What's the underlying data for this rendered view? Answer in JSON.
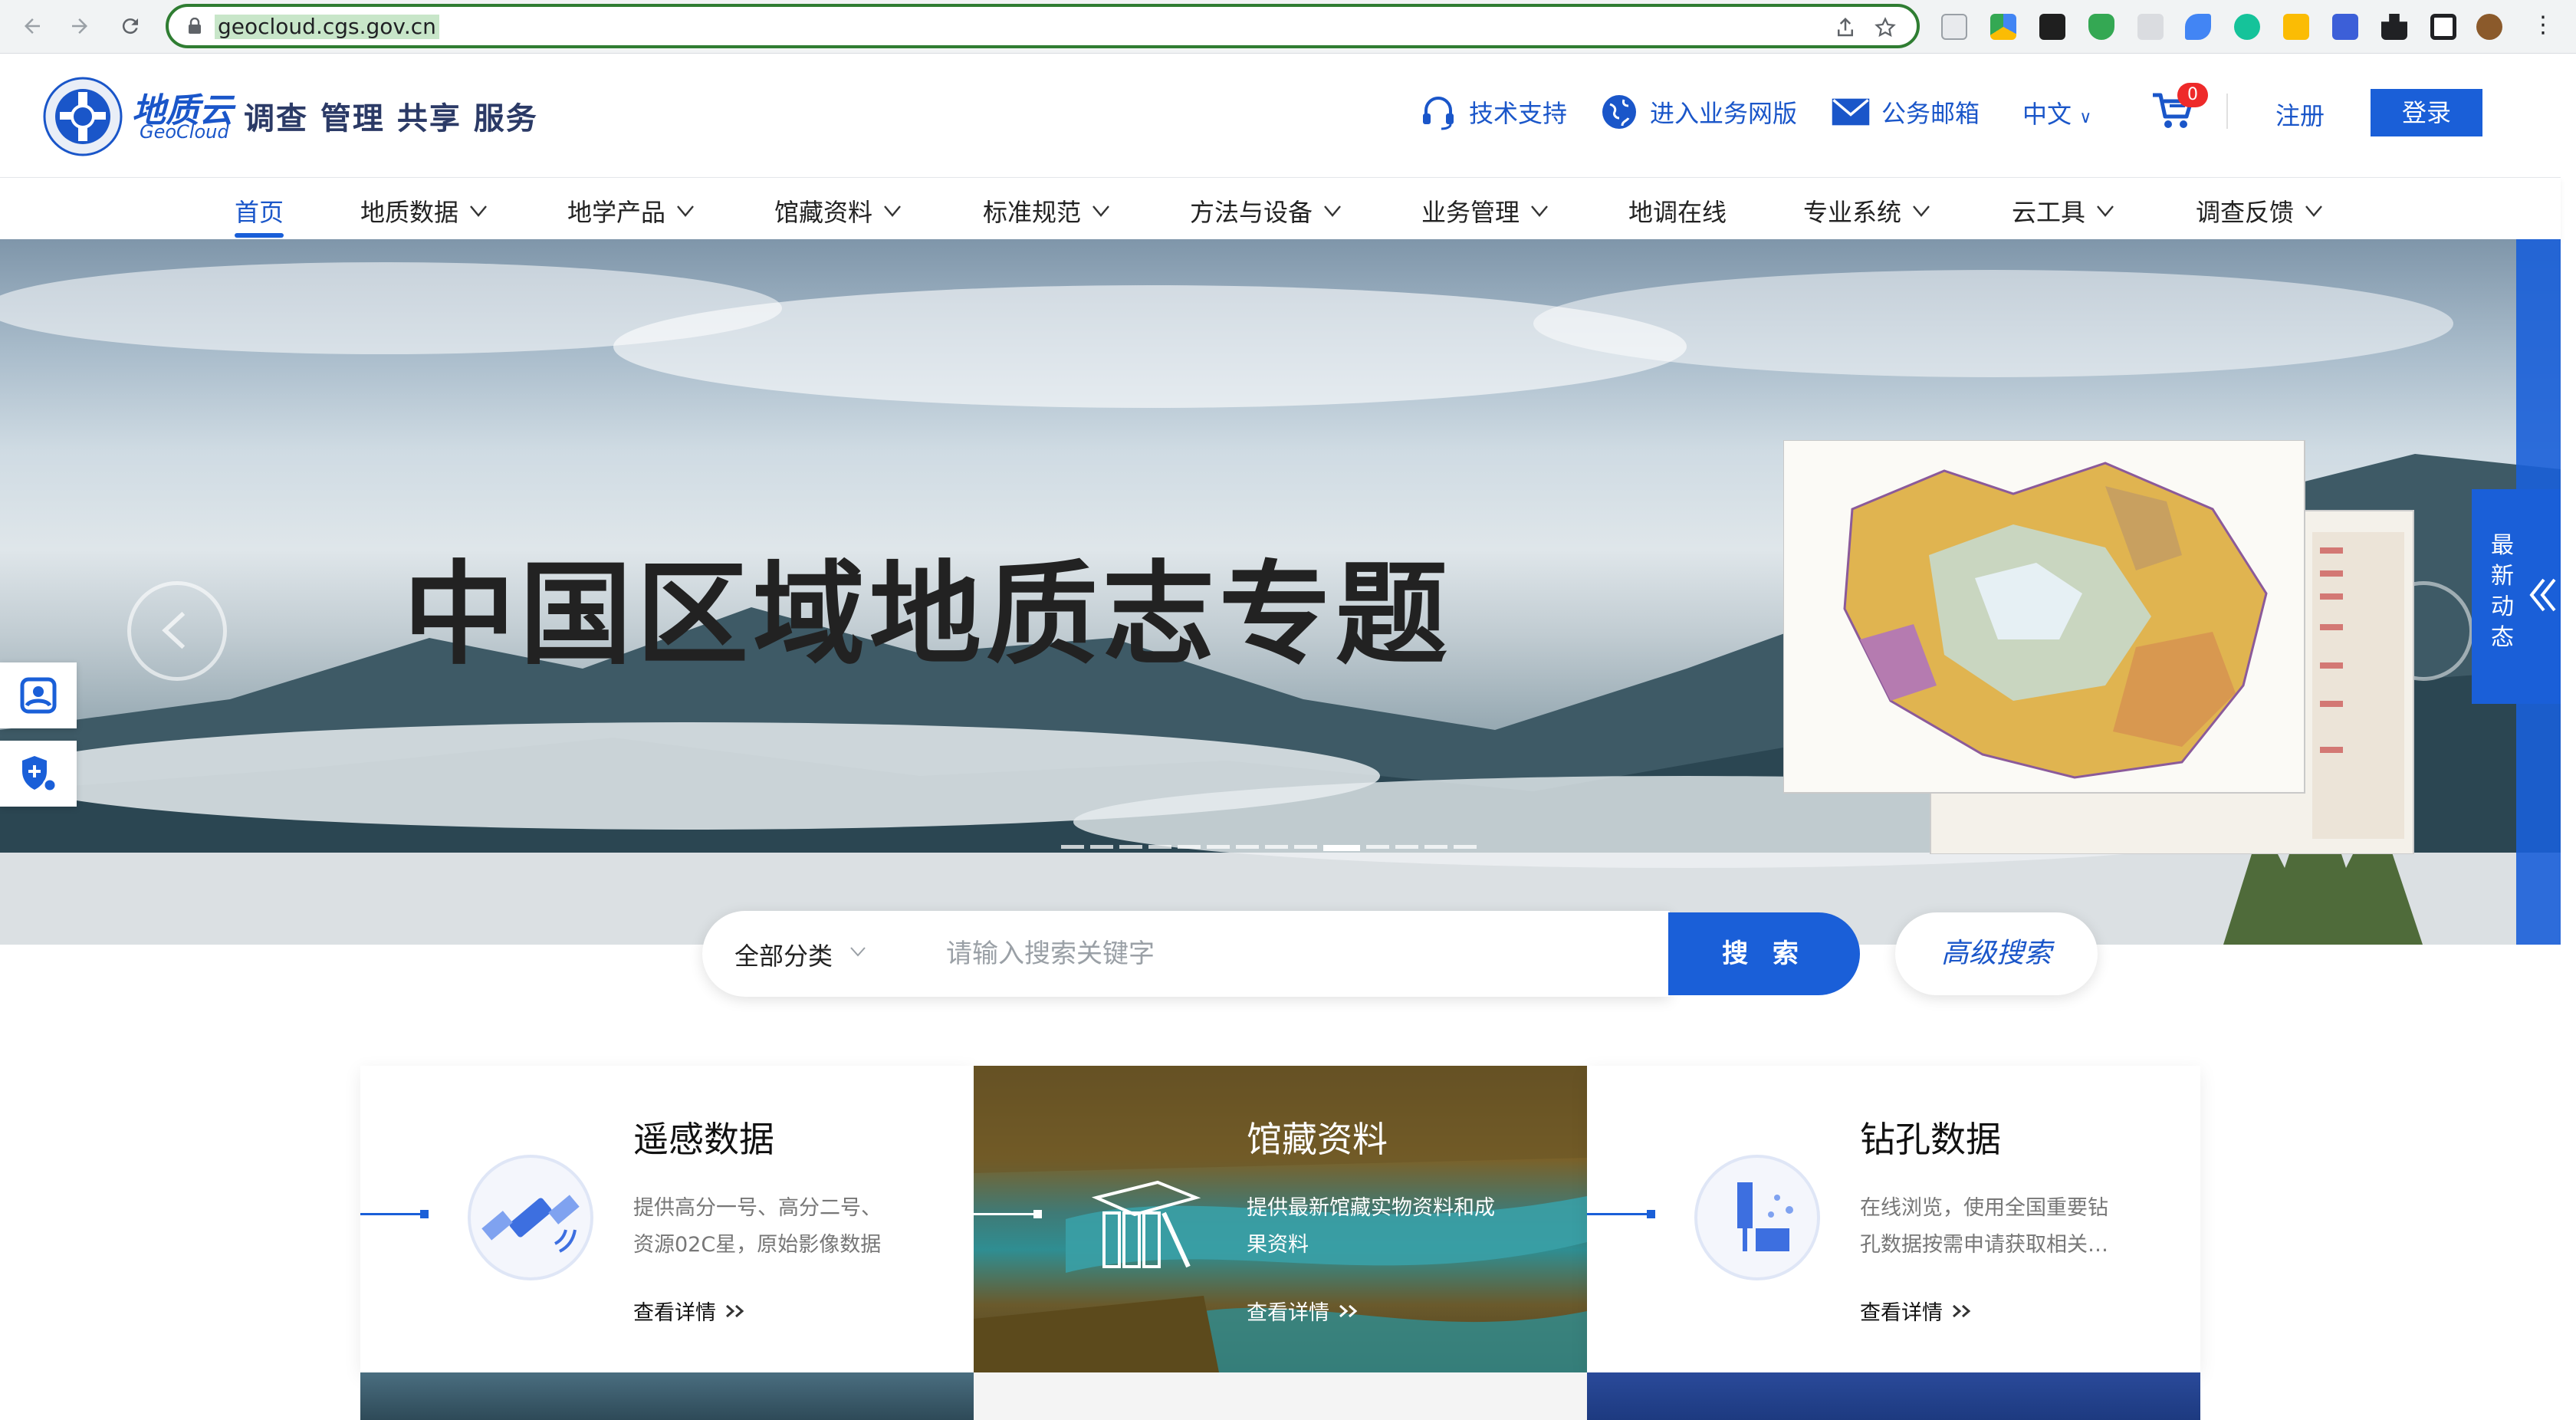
{
  "browser": {
    "url": "geocloud.cgs.gov.cn"
  },
  "header": {
    "logo_cn": "地质云",
    "logo_en": "GeoCloud",
    "tagline": "调查 管理 共享 服务",
    "tech_support": "技术支持",
    "business_net": "进入业务网版",
    "mailbox": "公务邮箱",
    "language": "中文",
    "cart_count": "0",
    "register": "注册",
    "login": "登录"
  },
  "nav": {
    "items": [
      {
        "label": "首页"
      },
      {
        "label": "地质数据"
      },
      {
        "label": "地学产品"
      },
      {
        "label": "馆藏资料"
      },
      {
        "label": "标准规范"
      },
      {
        "label": "方法与设备"
      },
      {
        "label": "业务管理"
      },
      {
        "label": "地调在线"
      },
      {
        "label": "专业系统"
      },
      {
        "label": "云工具"
      },
      {
        "label": "调查反馈"
      }
    ]
  },
  "hero": {
    "title": "中国区域地质志专题",
    "latest_tab": "最新动态",
    "slide_count": 14,
    "active_slide": 10
  },
  "search": {
    "category": "全部分类",
    "placeholder": "请输入搜索关键字",
    "button": "搜 索",
    "advanced": "高级搜索"
  },
  "cards": [
    {
      "title": "遥感数据",
      "desc": "提供高分一号、高分二号、资源02C星，原始影像数据",
      "more": "查看详情"
    },
    {
      "title": "馆藏资料",
      "desc": "提供最新馆藏实物资料和成果资料",
      "more": "查看详情"
    },
    {
      "title": "钻孔数据",
      "desc": "在线浏览，使用全国重要钻孔数据按需申请获取相关…",
      "more": "查看详情"
    }
  ],
  "colors": {
    "brand_blue": "#1a5fd8",
    "badge_red": "#ee2a2a"
  }
}
